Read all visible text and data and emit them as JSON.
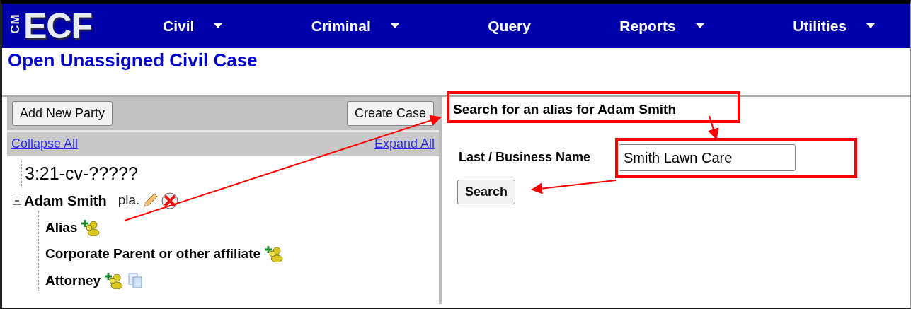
{
  "logo": {
    "side": "CM",
    "main": "ECF"
  },
  "menu": [
    {
      "label": "Civil",
      "dropdown": true
    },
    {
      "label": "Criminal",
      "dropdown": true
    },
    {
      "label": "Query",
      "dropdown": false
    },
    {
      "label": "Reports",
      "dropdown": true
    },
    {
      "label": "Utilities",
      "dropdown": true
    }
  ],
  "page_title": "Open Unassigned Civil Case",
  "left_panel": {
    "buttons": [
      "Add New Party",
      "Create Case"
    ],
    "links": [
      "Collapse All",
      "Expand All"
    ],
    "tree": {
      "case_number": "3:21-cv-?????",
      "party": {
        "name": "Adam Smith",
        "role": "pla.",
        "expanded": true,
        "children": [
          {
            "label": "Alias",
            "add_icon": true,
            "copy_icon": false
          },
          {
            "label": "Corporate Parent or other affiliate",
            "add_icon": true,
            "copy_icon": false
          },
          {
            "label": "Attorney",
            "add_icon": true,
            "copy_icon": true
          }
        ]
      }
    }
  },
  "search_form": {
    "heading": "Search for an alias for Adam Smith",
    "field_label": "Last / Business Name",
    "value": "Smith Lawn Care",
    "button": "Search"
  }
}
